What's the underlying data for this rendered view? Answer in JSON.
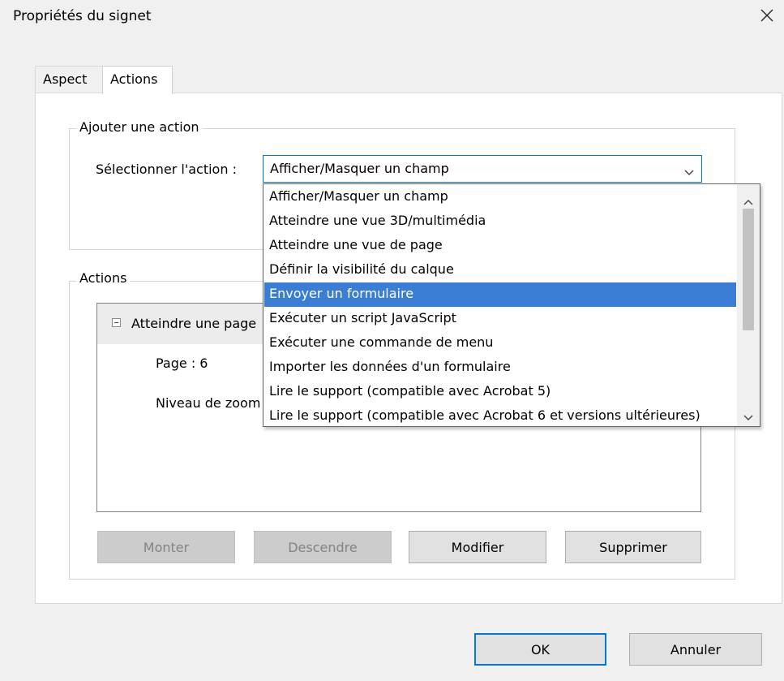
{
  "window": {
    "title": "Propriétés du signet",
    "close_icon": "close-icon"
  },
  "tabs": [
    {
      "label": "Aspect",
      "active": false
    },
    {
      "label": "Actions",
      "active": true
    }
  ],
  "add_action": {
    "legend": "Ajouter une action",
    "select_label": "Sélectionner l'action :",
    "selected_value": "Afficher/Masquer un champ"
  },
  "actions_group": {
    "legend": "Actions",
    "tree_item": "Atteindre une page",
    "detail_page": "Page : 6",
    "detail_zoom": "Niveau de zoom"
  },
  "dropdown": {
    "highlight_color": "#3a7dd5",
    "options": [
      "Afficher/Masquer un champ",
      "Atteindre une vue 3D/multimédia",
      "Atteindre une vue de page",
      "Définir la visibilité du calque",
      "Envoyer un formulaire",
      "Exécuter un script JavaScript",
      "Exécuter une commande de menu",
      "Importer les données d'un formulaire",
      "Lire le support (compatible avec Acrobat 5)",
      "Lire le support (compatible avec Acrobat 6 et versions ultérieures)"
    ],
    "highlighted_index": 4
  },
  "buttons": {
    "up": "Monter",
    "down": "Descendre",
    "edit": "Modifier",
    "delete": "Supprimer",
    "ok": "OK",
    "cancel": "Annuler"
  },
  "colors": {
    "accent": "#0078d7",
    "window_bg": "#f0f0f0"
  }
}
